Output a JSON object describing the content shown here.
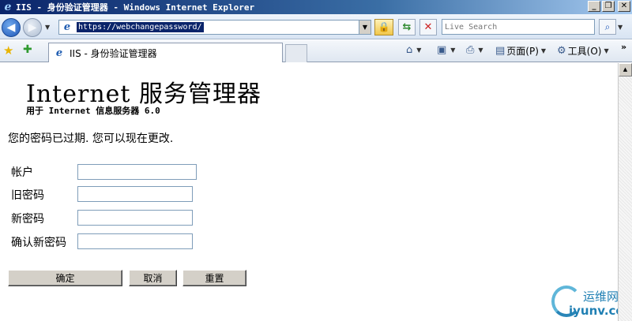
{
  "window": {
    "title": "IIS - 身份验证管理器 - Windows Internet Explorer",
    "controls": {
      "minimize": "_",
      "maximize": "❐",
      "close": "✕"
    }
  },
  "nav": {
    "url": "https://webchangepassword/",
    "search_placeholder": "Live Search"
  },
  "tabs": [
    {
      "label": "IIS - 身份验证管理器"
    }
  ],
  "commands": {
    "page": "页面(P)",
    "tools": "工具(O)"
  },
  "page": {
    "title": "Internet 服务管理器",
    "subtitle": "用于 Internet 信息服务器 6.0",
    "message": "您的密码已过期.  您可以现在更改.",
    "form": {
      "account_label": "帐户",
      "old_password_label": "旧密码",
      "new_password_label": "新密码",
      "confirm_password_label": "确认新密码"
    },
    "buttons": {
      "ok": "确定",
      "cancel": "取消",
      "reset": "重置"
    }
  },
  "watermark": {
    "cn": "运维网",
    "en": "iyunv.com"
  },
  "icons": {
    "back": "back-arrow-icon",
    "forward": "forward-arrow-icon",
    "lock": "lock-icon",
    "refresh": "refresh-icon",
    "stop": "stop-icon",
    "search": "search-icon",
    "favorites": "favorites-star-icon",
    "add_favorite": "add-favorite-icon",
    "home": "home-icon",
    "feeds": "rss-feed-icon",
    "print": "printer-icon",
    "page": "page-icon",
    "tools": "gear-icon"
  },
  "colors": {
    "titlebar_start": "#0a246a",
    "titlebar_end": "#a6caf0",
    "button_face": "#d4d0c8",
    "url_highlight": "#0a246a",
    "watermark": "#1f7fb3"
  }
}
